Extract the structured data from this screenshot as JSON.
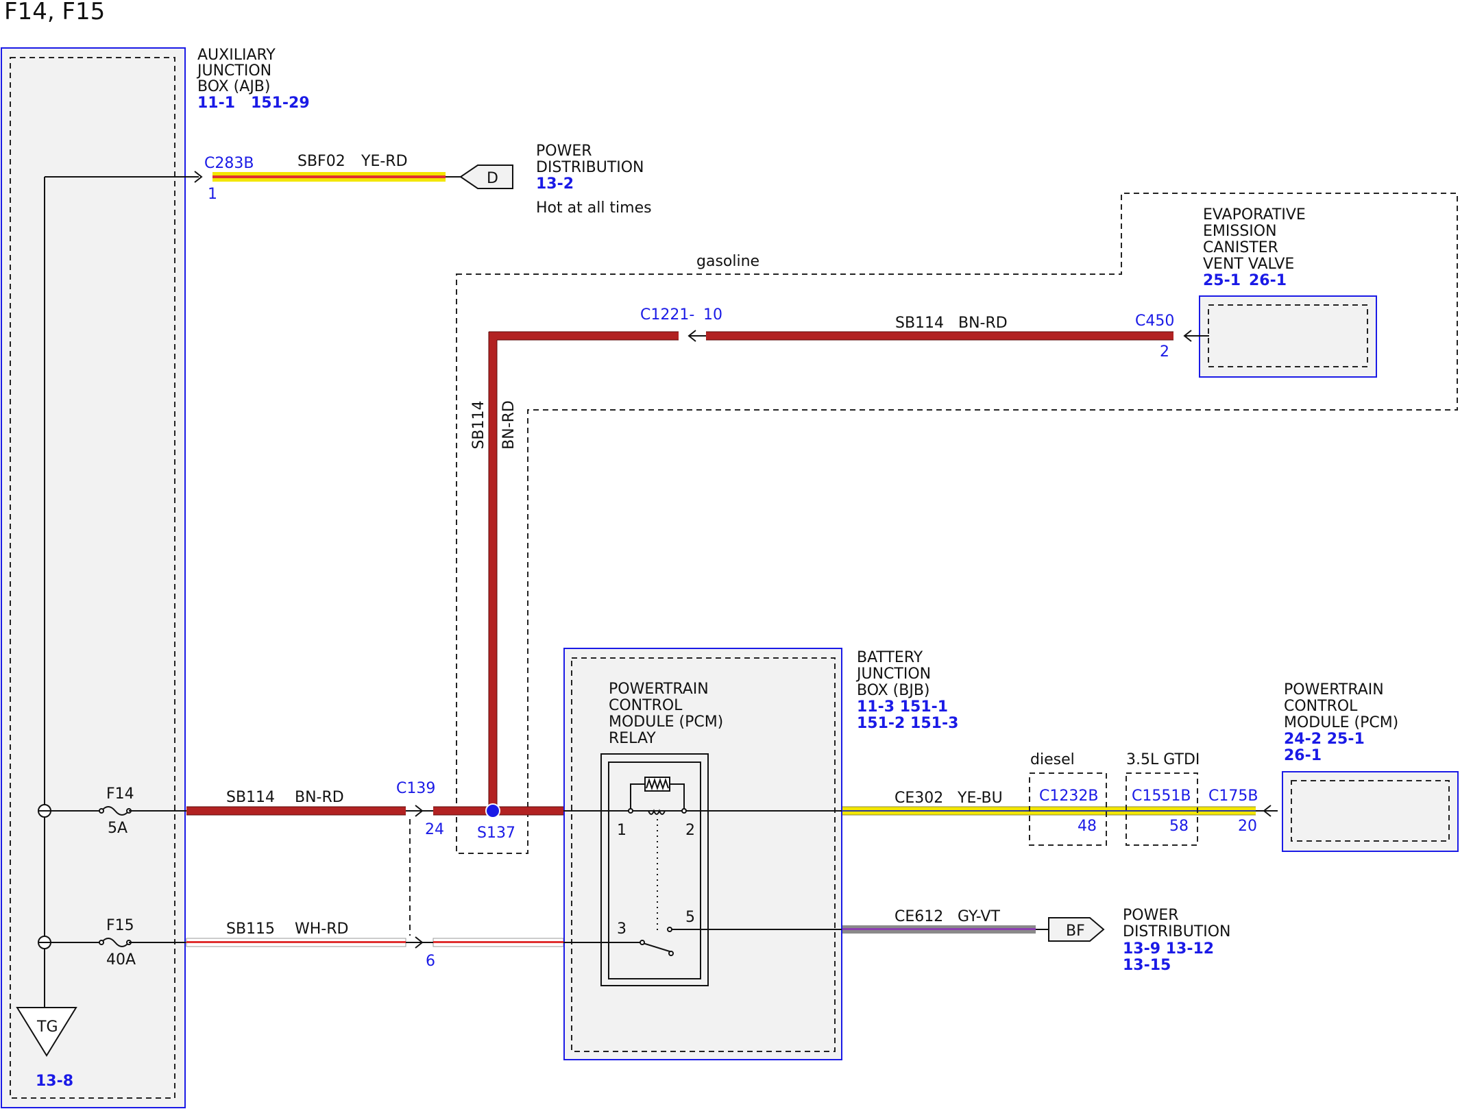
{
  "title": "F14, F15",
  "colors": {
    "module_border": "#1a1ae6",
    "module_fill": "#f2f2f2",
    "ref_blue": "#1a1ae6",
    "wire_bn_rd": "#b22222",
    "wire_ye": "#f3e600",
    "wire_gy": "#8a8a8a",
    "wire_vt": "#8b3fb0",
    "wire_rd_stripe": "#e03030"
  },
  "ajb": {
    "name": [
      "AUXILIARY",
      "JUNCTION",
      "BOX (AJB)"
    ],
    "refs": [
      "11-1",
      "151-29"
    ]
  },
  "ajb_output": {
    "connector": "C283B",
    "pin": "1",
    "circuit": "SBF02",
    "color": "YE-RD",
    "flag": "D",
    "dest_name": [
      "POWER",
      "DISTRIBUTION"
    ],
    "dest_ref": "13-2",
    "note": "Hot at all times"
  },
  "evap": {
    "name": [
      "EVAPORATIVE",
      "EMISSION",
      "CANISTER",
      "VENT VALVE"
    ],
    "refs": [
      "25-1",
      "26-1"
    ],
    "connector": "C450",
    "pin": "2"
  },
  "gasoline_label": "gasoline",
  "evap_wire": {
    "connector": "C1221-",
    "pin": "10",
    "circuit": "SB114",
    "color": "BN-RD"
  },
  "vertical_wire": {
    "circuit": "SB114",
    "color": "BN-RD"
  },
  "fuses": [
    {
      "name": "F14",
      "rating": "5A"
    },
    {
      "name": "F15",
      "rating": "40A"
    }
  ],
  "ground": {
    "label": "TG",
    "ref": "13-8"
  },
  "sb114_main": {
    "circuit": "SB114",
    "color": "BN-RD",
    "connector": "C139",
    "pin": "24",
    "splice": "S137"
  },
  "sb115": {
    "circuit": "SB115",
    "color": "WH-RD",
    "pin": "6"
  },
  "bjb": {
    "name": [
      "BATTERY",
      "JUNCTION",
      "BOX (BJB)"
    ],
    "refs": [
      "11-3  151-1",
      "151-2 151-3"
    ]
  },
  "relay": {
    "name": [
      "POWERTRAIN",
      "CONTROL",
      "MODULE (PCM)",
      "RELAY"
    ],
    "pins": [
      "1",
      "2",
      "3",
      "5"
    ]
  },
  "ce302": {
    "circuit": "CE302",
    "color": "YE-BU",
    "diesel_label": "diesel",
    "diesel_connector": "C1232B",
    "diesel_pin": "48",
    "gtdi_label": "3.5L GTDI",
    "gtdi_connector": "C1551B",
    "gtdi_pin": "58",
    "pcm_connector": "C175B",
    "pcm_pin": "20"
  },
  "pcm": {
    "name": [
      "POWERTRAIN",
      "CONTROL",
      "MODULE (PCM)"
    ],
    "refs": [
      "24-2  25-1",
      "26-1"
    ]
  },
  "ce612": {
    "circuit": "CE612",
    "color": "GY-VT",
    "flag": "BF",
    "dest_name": [
      "POWER",
      "DISTRIBUTION"
    ],
    "dest_refs": [
      "13-9   13-12",
      "13-15"
    ]
  }
}
